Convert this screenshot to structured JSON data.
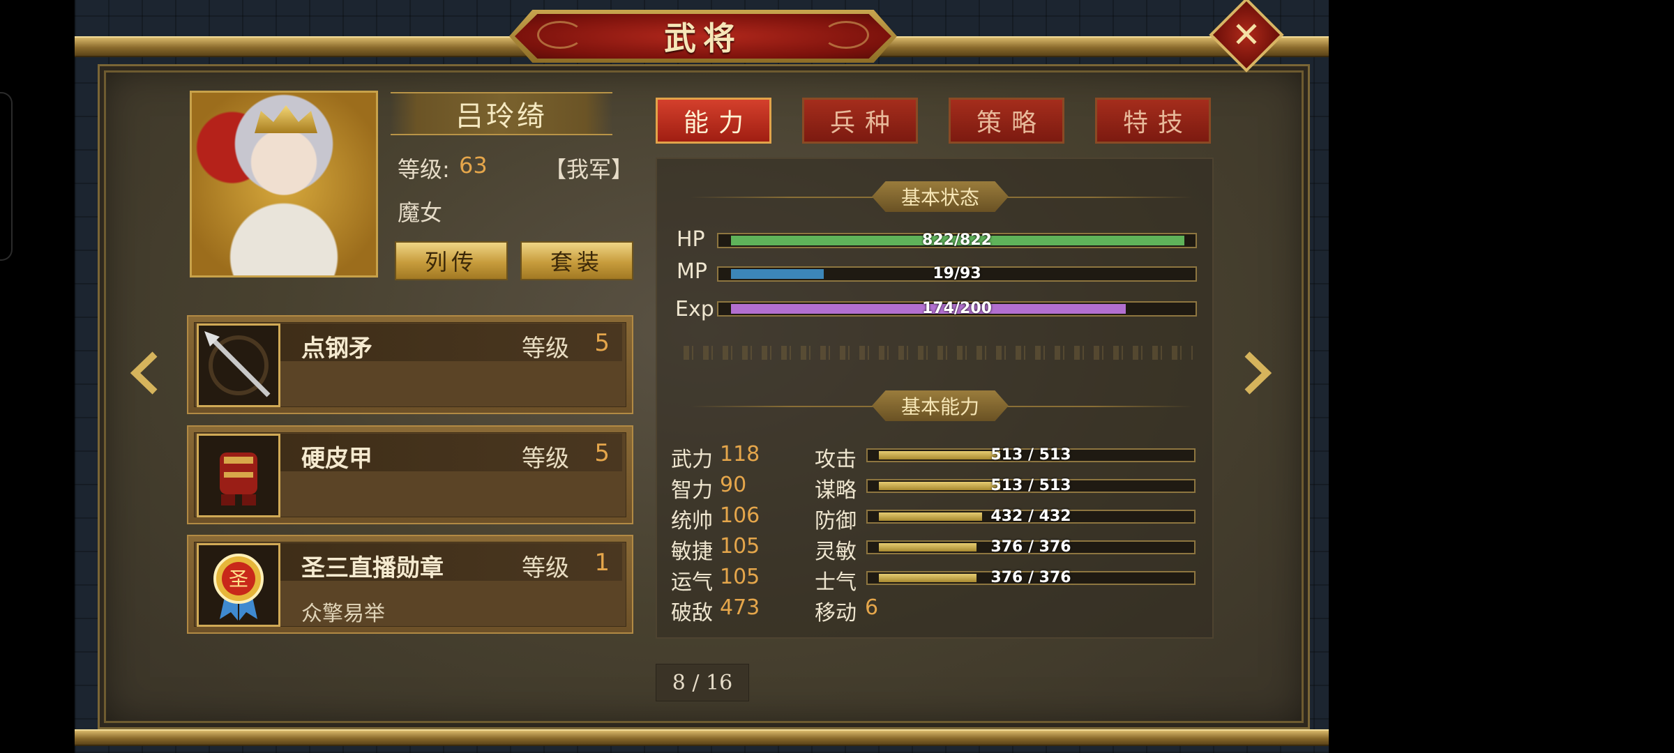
{
  "title": "武将",
  "close_symbol": "✕",
  "hero": {
    "name": "吕玲绮",
    "level_label": "等级:",
    "level": "63",
    "faction": "【我军】",
    "class": "魔女",
    "buttons": [
      "列传",
      "套装"
    ]
  },
  "equipment": [
    {
      "name": "点钢矛",
      "level_label": "等级",
      "level": "5",
      "desc": "",
      "icon": "spear-icon"
    },
    {
      "name": "硬皮甲",
      "level_label": "等级",
      "level": "5",
      "desc": "",
      "icon": "armor-icon"
    },
    {
      "name": "圣三直播勋章",
      "level_label": "等级",
      "level": "1",
      "desc": "众擎易举",
      "icon": "medal-icon"
    }
  ],
  "medal_glyph": "圣",
  "tabs": [
    "能力",
    "兵种",
    "策略",
    "特技"
  ],
  "status": {
    "section": "基本状态",
    "bars": [
      {
        "label": "HP",
        "text": "822/822",
        "value": 822,
        "max": 822,
        "color": "#5fb35a"
      },
      {
        "label": "MP",
        "text": "19/93",
        "value": 19,
        "max": 93,
        "color": "#3c86b8"
      },
      {
        "label": "Exp",
        "text": "174/200",
        "value": 174,
        "max": 200,
        "color": "#b26fd0"
      }
    ]
  },
  "ability": {
    "section": "基本能力",
    "attributes": [
      {
        "name": "武力",
        "value": "118"
      },
      {
        "name": "智力",
        "value": "90"
      },
      {
        "name": "统帅",
        "value": "106"
      },
      {
        "name": "敏捷",
        "value": "105"
      },
      {
        "name": "运气",
        "value": "105"
      },
      {
        "name": "破敌",
        "value": "473"
      }
    ],
    "combat": [
      {
        "name": "攻击",
        "text": "513 / 513",
        "fill": 0.4
      },
      {
        "name": "谋略",
        "text": "513 / 513",
        "fill": 0.4
      },
      {
        "name": "防御",
        "text": "432 / 432",
        "fill": 0.34
      },
      {
        "name": "灵敏",
        "text": "376 / 376",
        "fill": 0.32
      },
      {
        "name": "士气",
        "text": "376 / 376",
        "fill": 0.32
      }
    ],
    "move_label": "移动",
    "move_value": "6"
  },
  "pager": "8 / 16",
  "nav": {
    "prev": "‹",
    "next": "›"
  }
}
